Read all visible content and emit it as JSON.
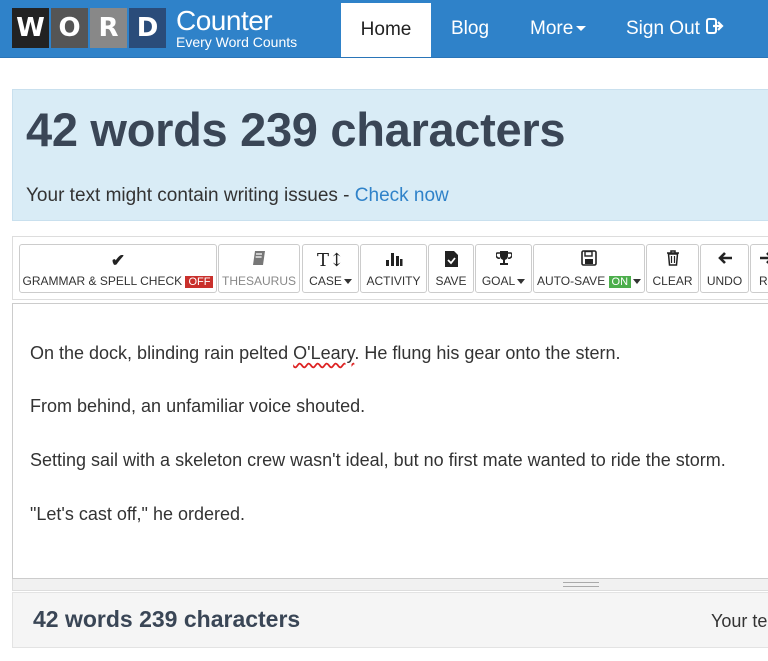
{
  "logo": {
    "letters": [
      "W",
      "O",
      "R",
      "D"
    ],
    "title": "Counter",
    "subtitle": "Every Word Counts"
  },
  "nav": {
    "home": "Home",
    "blog": "Blog",
    "more": "More",
    "signout": "Sign Out"
  },
  "stats": {
    "title": "42 words 239 characters",
    "message": "Your text might contain writing issues - ",
    "link": "Check now"
  },
  "toolbar": {
    "grammar": "GRAMMAR & SPELL CHECK",
    "grammar_state": "OFF",
    "thesaurus": "THESAURUS",
    "case": "CASE",
    "activity": "ACTIVITY",
    "save": "SAVE",
    "goal": "GOAL",
    "autosave": "AUTO-SAVE",
    "autosave_state": "ON",
    "clear": "CLEAR",
    "undo": "UNDO",
    "redo": "RE"
  },
  "editor": {
    "p1_before": "On the dock, blinding rain pelted ",
    "p1_word": "O'Leary",
    "p1_after": ". He flung his gear onto the stern.",
    "p2": "From behind, an unfamiliar voice shouted.",
    "p3": "Setting sail with a skeleton crew wasn't ideal, but no first mate wanted to ride the storm.",
    "p4": "\"Let's cast off,\" he ordered."
  },
  "bottom": {
    "title": "42 words 239 characters",
    "right": "Your te"
  },
  "colors": {
    "nav": "#2f82c9",
    "stats_bg": "#d9ecf6",
    "off": "#c9302c",
    "on": "#4cae4c"
  }
}
